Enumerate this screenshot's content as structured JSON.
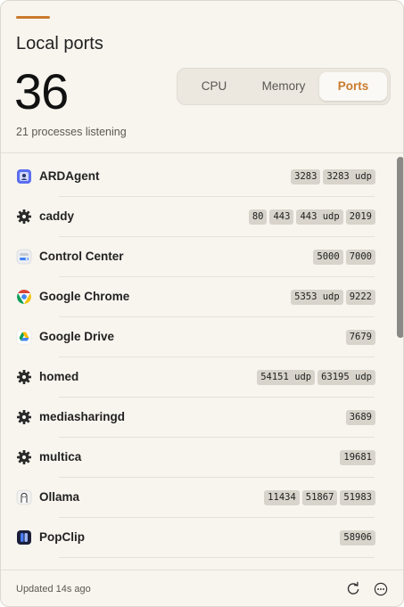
{
  "header": {
    "title": "Local ports",
    "count": "36",
    "subtitle": "21 processes listening"
  },
  "tabs": [
    {
      "label": "CPU",
      "selected": false
    },
    {
      "label": "Memory",
      "selected": false
    },
    {
      "label": "Ports",
      "selected": true
    }
  ],
  "processes": [
    {
      "name": "ARDAgent",
      "icon": "ardagent-app-icon",
      "ports": [
        "3283",
        "3283 udp"
      ]
    },
    {
      "name": "caddy",
      "icon": "gear-icon",
      "ports": [
        "80",
        "443",
        "443 udp",
        "2019"
      ]
    },
    {
      "name": "Control Center",
      "icon": "control-center-app-icon",
      "ports": [
        "5000",
        "7000"
      ]
    },
    {
      "name": "Google Chrome",
      "icon": "chrome-app-icon",
      "ports": [
        "5353 udp",
        "9222"
      ]
    },
    {
      "name": "Google Drive",
      "icon": "google-drive-app-icon",
      "ports": [
        "7679"
      ]
    },
    {
      "name": "homed",
      "icon": "gear-icon",
      "ports": [
        "54151 udp",
        "63195 udp"
      ]
    },
    {
      "name": "mediasharingd",
      "icon": "gear-icon",
      "ports": [
        "3689"
      ]
    },
    {
      "name": "multica",
      "icon": "gear-icon",
      "ports": [
        "19681"
      ]
    },
    {
      "name": "Ollama",
      "icon": "ollama-app-icon",
      "ports": [
        "11434",
        "51867",
        "51983"
      ]
    },
    {
      "name": "PopClip",
      "icon": "popclip-app-icon",
      "ports": [
        "58906"
      ]
    }
  ],
  "footer": {
    "updated": "Updated 14s ago",
    "refresh_icon": "refresh-icon",
    "more_icon": "more-icon"
  },
  "colors": {
    "accent": "#c97a2c",
    "background": "#f8f5ef",
    "chip": "#d8d4cb"
  }
}
